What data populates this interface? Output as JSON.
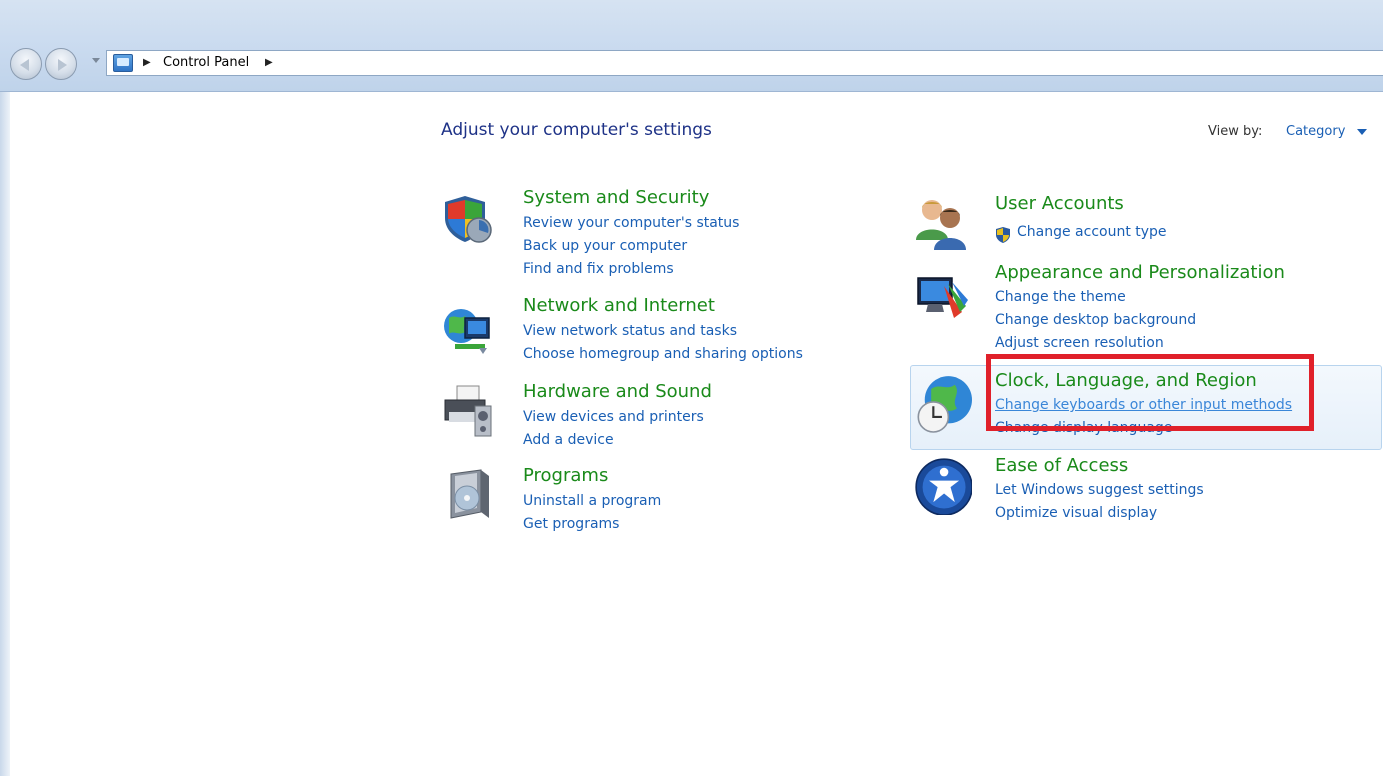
{
  "address_bar": {
    "breadcrumb": "Control Panel"
  },
  "heading": "Adjust your computer's settings",
  "view_by": {
    "label": "View by:",
    "value": "Category"
  },
  "categories_left": [
    {
      "title": "System and Security",
      "icon": "shield-icon",
      "links": [
        "Review your computer's status",
        "Back up your computer",
        "Find and fix problems"
      ]
    },
    {
      "title": "Network and Internet",
      "icon": "network-globe-icon",
      "links": [
        "View network status and tasks",
        "Choose homegroup and sharing options"
      ]
    },
    {
      "title": "Hardware and Sound",
      "icon": "printer-icon",
      "links": [
        "View devices and printers",
        "Add a device"
      ]
    },
    {
      "title": "Programs",
      "icon": "programs-box-icon",
      "links": [
        "Uninstall a program",
        "Get programs"
      ]
    }
  ],
  "categories_right": [
    {
      "title": "User Accounts",
      "icon": "users-icon",
      "links": [
        "Change account type"
      ]
    },
    {
      "title": "Appearance and Personalization",
      "icon": "monitor-palette-icon",
      "links": [
        "Change the theme",
        "Change desktop background",
        "Adjust screen resolution"
      ]
    },
    {
      "title": "Clock, Language, and Region",
      "icon": "clock-globe-icon",
      "links": [
        "Change keyboards or other input methods",
        "Change display language"
      ]
    },
    {
      "title": "Ease of Access",
      "icon": "ease-of-access-icon",
      "links": [
        "Let Windows suggest settings",
        "Optimize visual display"
      ]
    }
  ],
  "colors": {
    "title_green": "#1a8a1a",
    "link_blue": "#1a5fb4",
    "heading_blue": "#1e3287",
    "highlight_red": "#e0202a"
  }
}
